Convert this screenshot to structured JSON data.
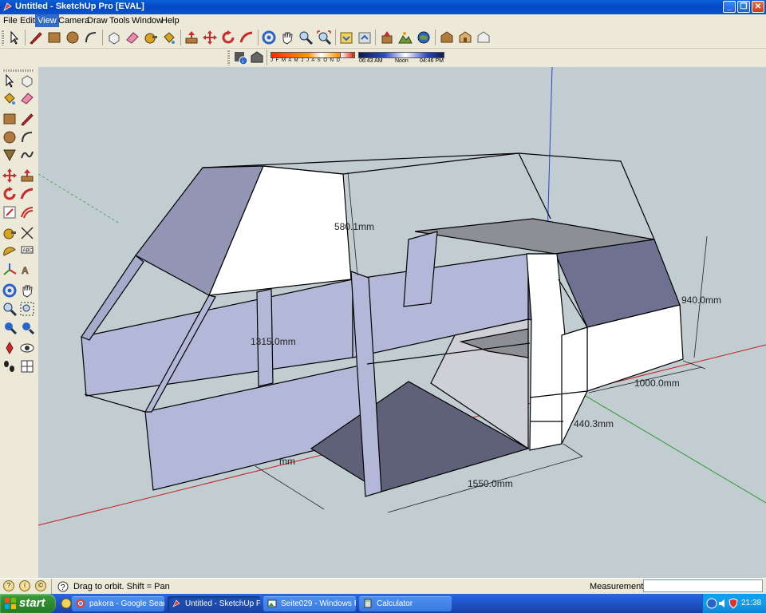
{
  "window": {
    "title": "Untitled - SketchUp Pro [EVAL]"
  },
  "menu": [
    "File",
    "Edit",
    "View",
    "Camera",
    "Draw",
    "Tools",
    "Window",
    "Help"
  ],
  "menu_active": "View",
  "shadow": {
    "months": "J  F  M  A  M  J  J  A  S  O  N  D",
    "time_start": "06:43 AM",
    "time_noon": "Noon",
    "time_end": "04:46 PM"
  },
  "dimensions": {
    "d1": "580.1mm",
    "d2": "1315.0mm",
    "d3": "940.0mm",
    "d4": "1000.0mm",
    "d5": "440.3mm",
    "d6": "1550.0mm",
    "d7": "mm"
  },
  "status": {
    "hint": "Drag to orbit.  Shift = Pan",
    "measurements_label": "Measurements",
    "measurements_value": ""
  },
  "taskbar": {
    "start": "start",
    "tasks": [
      "pakora - Google Sear...",
      "Untitled - SketchUp P...",
      "Seite029 - Windows P...",
      "Calculator"
    ],
    "clock": "21:38"
  },
  "colors": {
    "viewport_bg": "#c1cdd1",
    "face_front": "#b9bde0",
    "face_back": "#8f93b0",
    "title_bar": "#0a53d0"
  }
}
